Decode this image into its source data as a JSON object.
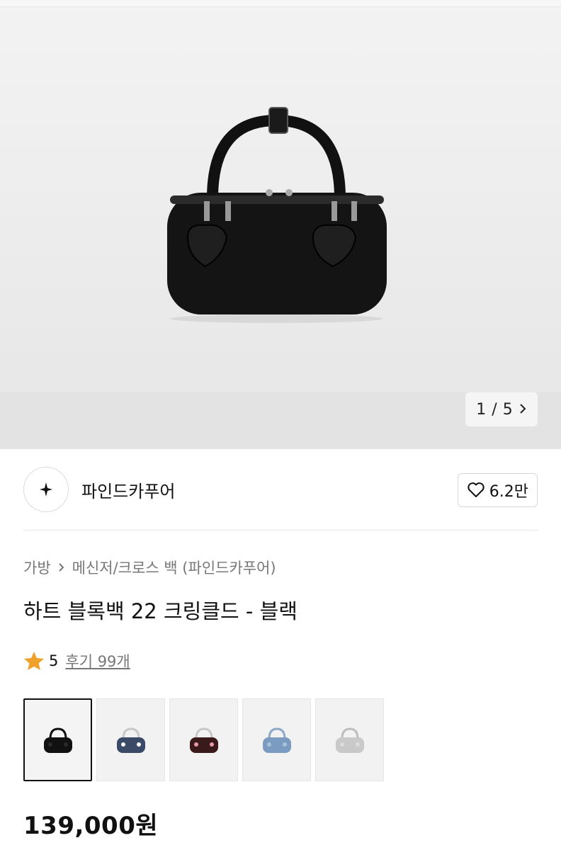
{
  "gallery": {
    "current_page": "1",
    "separator": "/",
    "total_pages": "5"
  },
  "brand": {
    "name": "파인드카푸어",
    "likes": "6.2만"
  },
  "breadcrumb": {
    "category": "가방",
    "subcategory": "메신저/크로스 백 (파인드카푸어)"
  },
  "product": {
    "title": "하트 블록백 22 크링클드 - 블랙",
    "rating": "5",
    "reviews_label": "후기 99개",
    "price": "139,000원"
  },
  "swatches": [
    {
      "color": "#111111",
      "heart": "#2a2a2a",
      "handle": "#111111"
    },
    {
      "color": "#3b4a66",
      "heart": "#ffffff",
      "handle": "#c8c8c8"
    },
    {
      "color": "#3a1a1a",
      "heart": "#e79aa8",
      "handle": "#c8c8c8"
    },
    {
      "color": "#7b9cc0",
      "heart": "#a9c2dc",
      "handle": "#8ea9c6"
    },
    {
      "color": "#c9c9c9",
      "heart": "#dcdcdc",
      "handle": "#bdbdbd"
    }
  ],
  "colors": {
    "star": "#f0a12b",
    "text_muted": "#777777"
  }
}
